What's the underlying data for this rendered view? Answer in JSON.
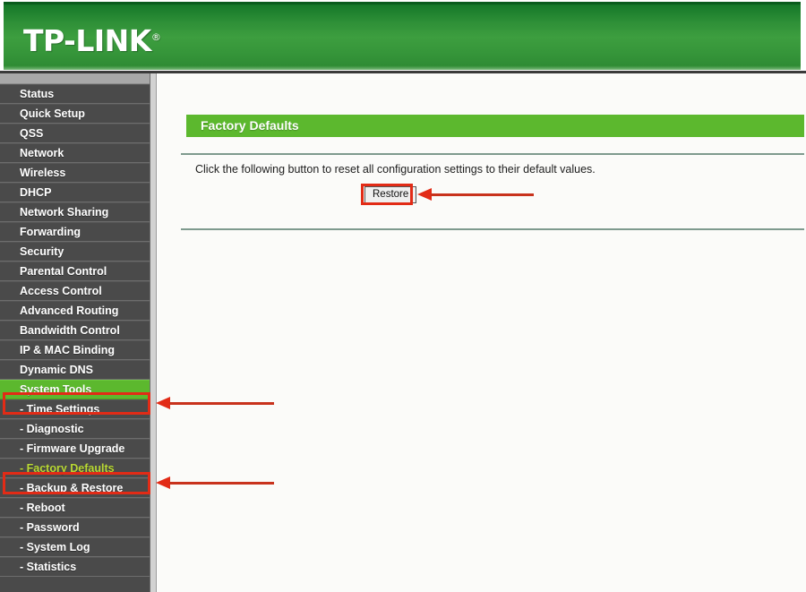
{
  "header": {
    "brand": "TP-LINK",
    "registered_mark": "®"
  },
  "sidebar": {
    "items": [
      {
        "label": "Status",
        "type": "top",
        "state": "normal"
      },
      {
        "label": "Quick Setup",
        "type": "top",
        "state": "normal"
      },
      {
        "label": "QSS",
        "type": "top",
        "state": "normal"
      },
      {
        "label": "Network",
        "type": "top",
        "state": "normal"
      },
      {
        "label": "Wireless",
        "type": "top",
        "state": "normal"
      },
      {
        "label": "DHCP",
        "type": "top",
        "state": "normal"
      },
      {
        "label": "Network Sharing",
        "type": "top",
        "state": "normal"
      },
      {
        "label": "Forwarding",
        "type": "top",
        "state": "normal"
      },
      {
        "label": "Security",
        "type": "top",
        "state": "normal"
      },
      {
        "label": "Parental Control",
        "type": "top",
        "state": "normal"
      },
      {
        "label": "Access Control",
        "type": "top",
        "state": "normal"
      },
      {
        "label": "Advanced Routing",
        "type": "top",
        "state": "normal"
      },
      {
        "label": "Bandwidth Control",
        "type": "top",
        "state": "normal"
      },
      {
        "label": "IP & MAC Binding",
        "type": "top",
        "state": "normal"
      },
      {
        "label": "Dynamic DNS",
        "type": "top",
        "state": "normal"
      },
      {
        "label": "System Tools",
        "type": "top",
        "state": "active"
      },
      {
        "label": "- Time Settings",
        "type": "sub",
        "state": "normal"
      },
      {
        "label": "- Diagnostic",
        "type": "sub",
        "state": "normal"
      },
      {
        "label": "- Firmware Upgrade",
        "type": "sub",
        "state": "normal"
      },
      {
        "label": "- Factory Defaults",
        "type": "sub",
        "state": "selected"
      },
      {
        "label": "- Backup & Restore",
        "type": "sub",
        "state": "normal"
      },
      {
        "label": "- Reboot",
        "type": "sub",
        "state": "normal"
      },
      {
        "label": "- Password",
        "type": "sub",
        "state": "normal"
      },
      {
        "label": "- System Log",
        "type": "sub",
        "state": "normal"
      },
      {
        "label": "- Statistics",
        "type": "sub",
        "state": "normal"
      }
    ]
  },
  "main": {
    "panel_title": "Factory Defaults",
    "instruction": "Click the following button to reset all configuration settings to their default values.",
    "restore_label": "Restore"
  },
  "colors": {
    "brand_green_dark": "#0d6b23",
    "brand_green": "#3d9e3f",
    "accent_green": "#5cb82e",
    "sidebar_bg": "#4a4a4a",
    "selected_sub_text": "#bada34",
    "annotation_red": "#e22b16",
    "divider": "#7e9a8e",
    "content_bg": "#fbfbf9"
  }
}
